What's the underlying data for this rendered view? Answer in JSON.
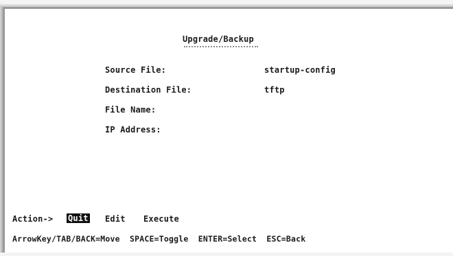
{
  "screen": {
    "title": "Upgrade/Backup",
    "fields": [
      {
        "label": "Source File:",
        "value": "startup-config"
      },
      {
        "label": "Destination File:",
        "value": "tftp"
      },
      {
        "label": "File Name:",
        "value": ""
      },
      {
        "label": "IP Address:",
        "value": ""
      }
    ]
  },
  "actions": {
    "prefix": "Action->",
    "quit": "Quit",
    "edit": "Edit",
    "execute": "Execute",
    "selected": "Quit"
  },
  "help_line": "ArrowKey/TAB/BACK=Move  SPACE=Toggle  ENTER=Select  ESC=Back",
  "colors": {
    "background": "#ffffff",
    "text": "#1a1a1a",
    "highlight_bg": "#111111",
    "highlight_fg": "#ffffff"
  }
}
